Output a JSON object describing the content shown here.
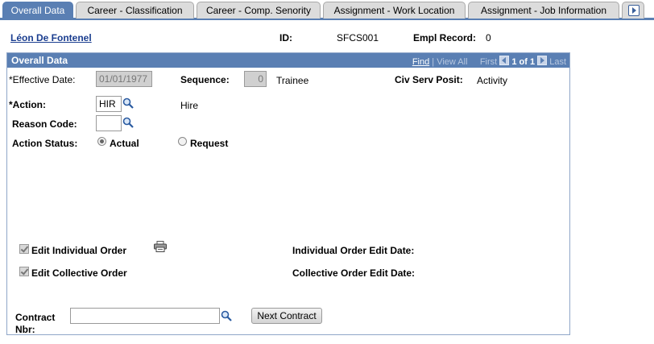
{
  "tabs": [
    {
      "label": "Overall Data",
      "active": true
    },
    {
      "label": "Career - Classification",
      "active": false
    },
    {
      "label": "Career - Comp. Senority",
      "active": false
    },
    {
      "label": "Assignment - Work Location",
      "active": false
    },
    {
      "label": "Assignment - Job Information",
      "active": false
    }
  ],
  "header": {
    "employee_name": "Léon De Fontenel",
    "id_label": "ID:",
    "id_value": "SFCS001",
    "empl_record_label": "Empl Record:",
    "empl_record_value": "0"
  },
  "group": {
    "title": "Overall Data",
    "nav": {
      "find": "Find",
      "view_all": "View All",
      "first": "First",
      "position": "1 of 1",
      "last": "Last"
    }
  },
  "fields": {
    "effective_date_label": "*Effective Date:",
    "effective_date_value": "01/01/1977",
    "sequence_label": "Sequence:",
    "sequence_value": "0",
    "sequence_desc": "Trainee",
    "civ_serv_posit_label": "Civ Serv Posit:",
    "civ_serv_posit_value": "Activity",
    "action_label": "*Action:",
    "action_value": "HIR",
    "action_desc": "Hire",
    "reason_code_label": "Reason Code:",
    "reason_code_value": "",
    "action_status_label": "Action Status:",
    "status_actual": "Actual",
    "status_request": "Request",
    "status_selected": "Actual"
  },
  "orders": {
    "edit_individual_label": "Edit Individual Order",
    "edit_collective_label": "Edit Collective Order",
    "individual_edit_date_label": "Individual Order Edit Date:",
    "collective_edit_date_label": "Collective Order Edit Date:"
  },
  "contract": {
    "label_line1": "Contract",
    "label_line2": "Nbr:",
    "value": "",
    "next_button": "Next Contract"
  },
  "icons": {
    "lookup": "magnifier-icon",
    "print": "printer-icon",
    "tab_scroll": "right-arrow-icon"
  },
  "colors": {
    "accent": "#5a7fb3",
    "link": "#1a3d8f"
  }
}
